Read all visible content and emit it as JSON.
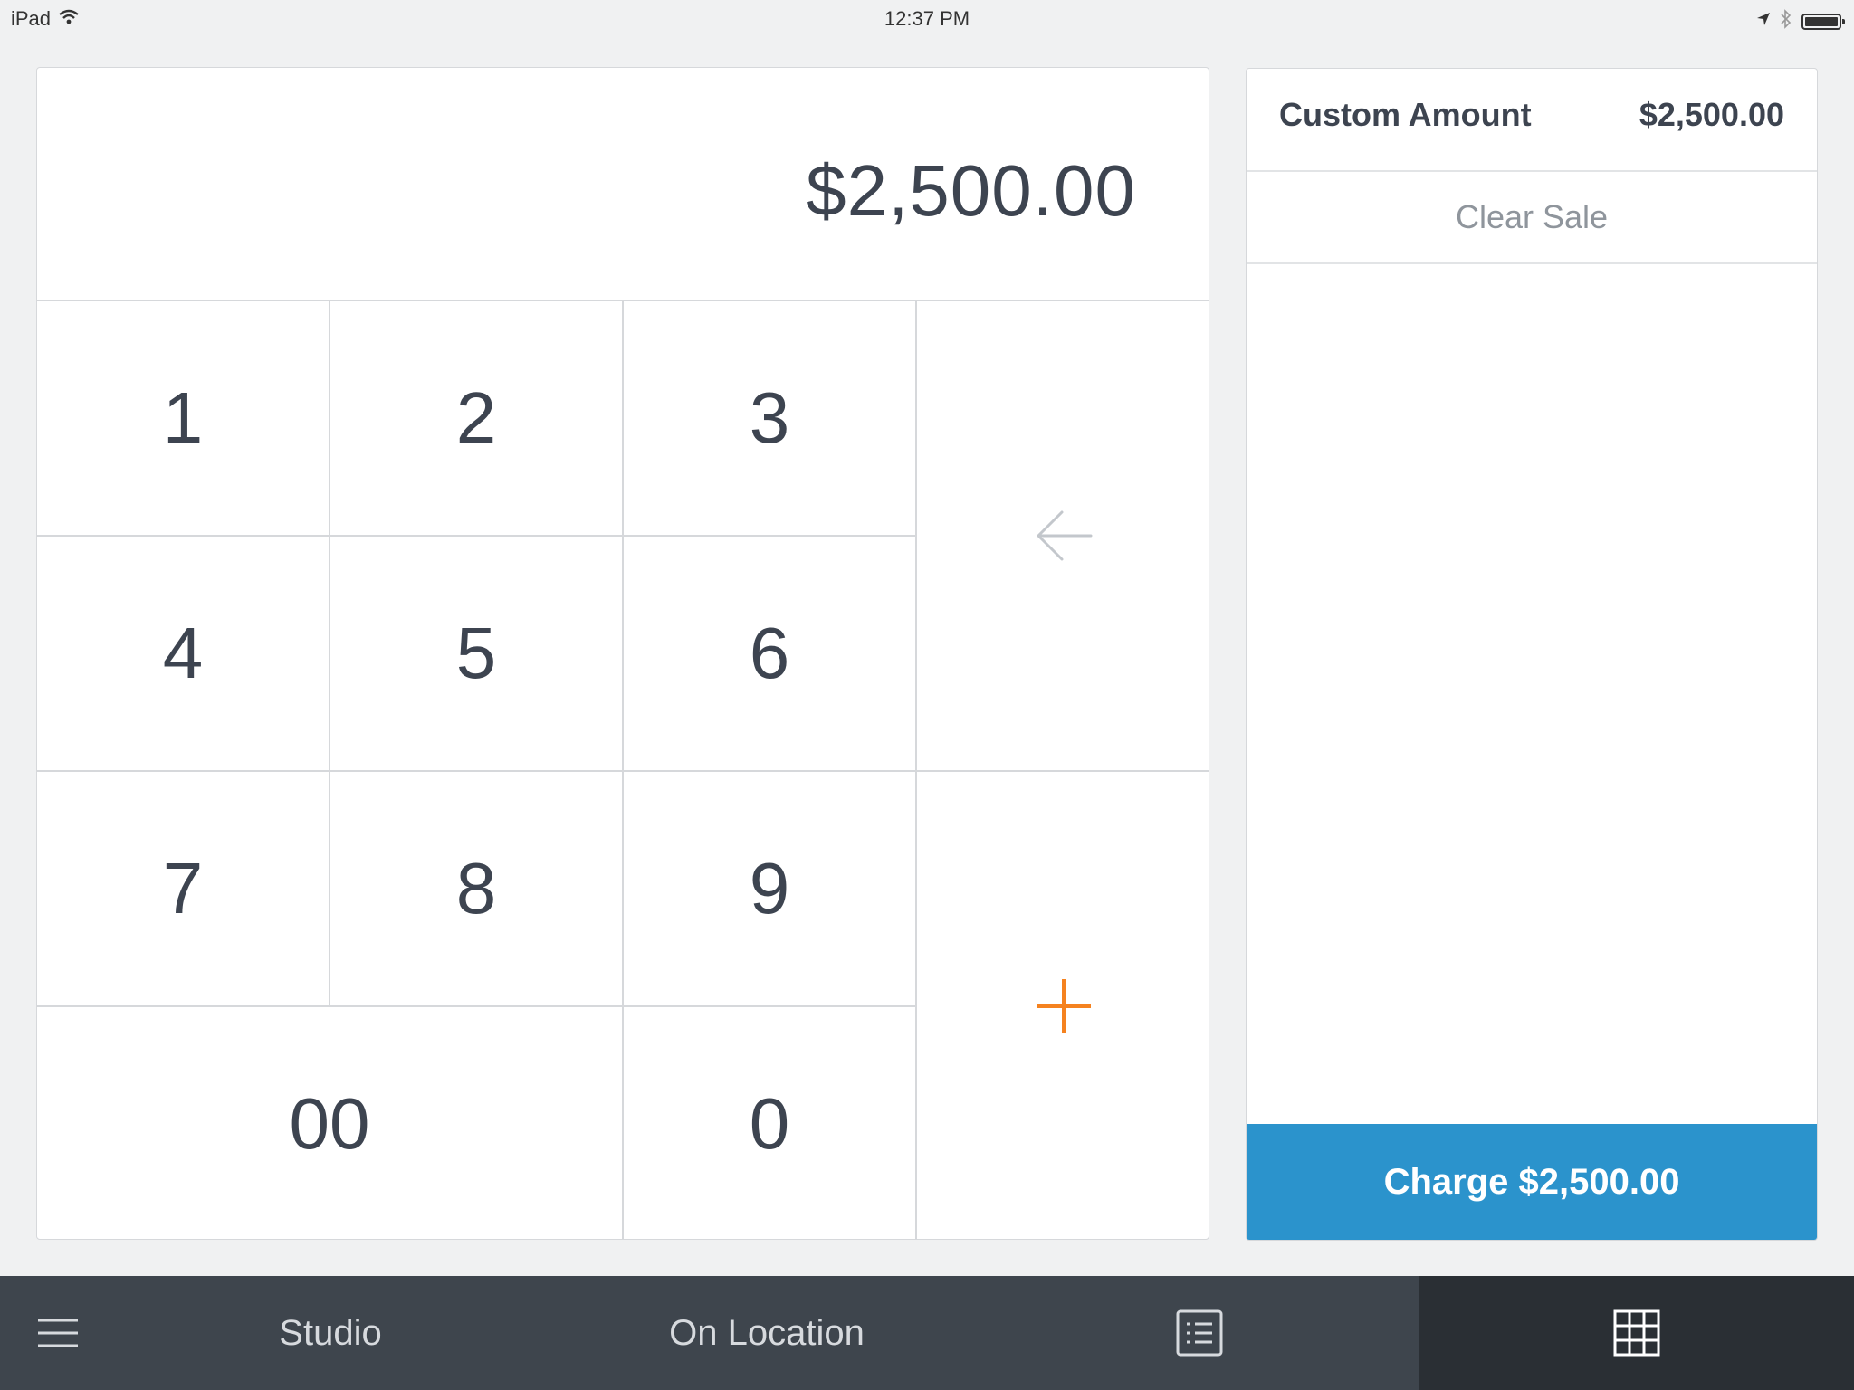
{
  "status_bar": {
    "device": "iPad",
    "time": "12:37 PM"
  },
  "keypad": {
    "amount": "$2,500.00",
    "keys": {
      "k1": "1",
      "k2": "2",
      "k3": "3",
      "k4": "4",
      "k5": "5",
      "k6": "6",
      "k7": "7",
      "k8": "8",
      "k9": "9",
      "k00": "00",
      "k0": "0"
    },
    "backspace_icon": "left-arrow-icon",
    "add_icon": "plus-icon",
    "add_color": "#f5821f"
  },
  "cart": {
    "item": {
      "name": "Custom Amount",
      "price": "$2,500.00"
    },
    "clear_label": "Clear Sale",
    "charge_label": "Charge $2,500.00",
    "charge_color": "#2b93cc"
  },
  "bottom_bar": {
    "menu_icon": "hamburger-menu-icon",
    "tab_1": "Studio",
    "tab_2": "On Location",
    "library_icon": "list-icon",
    "keypad_icon": "grid-icon"
  }
}
